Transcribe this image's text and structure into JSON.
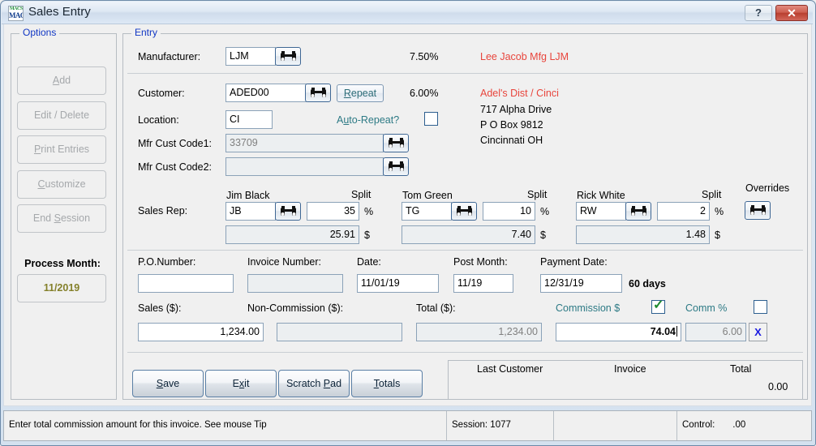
{
  "window": {
    "title": "Sales Entry",
    "icon_top": "MACS",
    "icon_bottom": "MACS",
    "help_label": "?",
    "close_label": "✕"
  },
  "options": {
    "group_title": "Options",
    "buttons": [
      {
        "label": "Add",
        "accel": "A",
        "disabled": true
      },
      {
        "label": "Edit / Delete",
        "accel": "",
        "disabled": true
      },
      {
        "label": "Print Entries",
        "accel": "P",
        "disabled": true
      },
      {
        "label": "Customize",
        "accel": "C",
        "disabled": true
      },
      {
        "label": "End Session",
        "accel": "S",
        "disabled": true
      }
    ],
    "process_month_label": "Process Month:",
    "process_month_value": "11/2019",
    "process_month_color": "#84802a"
  },
  "entry": {
    "group_title": "Entry",
    "manufacturer": {
      "label": "Manufacturer:",
      "value": "LJM",
      "rate": "7.50%",
      "name": "Lee Jacob Mfg  LJM"
    },
    "customer": {
      "label": "Customer:",
      "value": "ADED00",
      "repeat_button": "Repeat",
      "repeat_accel": "R",
      "rate": "6.00%",
      "name": "Adel's Dist / Cinci",
      "address_line1": "717 Alpha Drive",
      "address_line2": "P O Box 9812",
      "address_line3": "Cincinnati OH"
    },
    "location": {
      "label": "Location:",
      "value": "CI",
      "auto_repeat_label": "Auto-Repeat?",
      "auto_repeat_accel": "u",
      "auto_repeat_checked": false
    },
    "mfr_cust_code1": {
      "label": "Mfr Cust Code1:",
      "value": "33709",
      "readonly": true
    },
    "mfr_cust_code2": {
      "label": "Mfr Cust Code2:",
      "value": "",
      "readonly": true
    },
    "sales_rep": {
      "label": "Sales Rep:",
      "split_label": "Split",
      "percent_symbol": "%",
      "dollar_symbol": "$",
      "overrides_label": "Overrides",
      "reps": [
        {
          "name": "Jim Black",
          "code": "JB",
          "split": "35",
          "amount": "25.91"
        },
        {
          "name": "Tom Green",
          "code": "TG",
          "split": "10",
          "amount": "7.40"
        },
        {
          "name": "Rick White",
          "code": "RW",
          "split": "2",
          "amount": "1.48"
        }
      ]
    },
    "po_number": {
      "label": "P.O.Number:",
      "value": ""
    },
    "invoice_number": {
      "label": "Invoice Number:",
      "value": "",
      "readonly": true
    },
    "date": {
      "label": "Date:",
      "value": "11/01/19"
    },
    "post_month": {
      "label": "Post Month:",
      "value": "11/19"
    },
    "payment_date": {
      "label": "Payment Date:",
      "value": "12/31/19",
      "days": "60  days"
    },
    "sales": {
      "label": "Sales ($):",
      "value": "1,234.00"
    },
    "non_commission": {
      "label": "Non-Commission ($):",
      "value": "",
      "readonly": true
    },
    "total": {
      "label": "Total ($):",
      "value": "1,234.00",
      "readonly": true
    },
    "commission_dollar": {
      "label": "Commission $",
      "value": "74.04",
      "checked": true,
      "focused": true
    },
    "commission_percent": {
      "label": "Comm %",
      "value": "6.00",
      "checked": false,
      "readonly": true
    },
    "clear_button": "X"
  },
  "actions": {
    "save": {
      "label": "Save",
      "accel": "S"
    },
    "exit": {
      "label": "Exit",
      "accel": "x"
    },
    "scratch_pad": {
      "label": "Scratch Pad",
      "accel": "P"
    },
    "totals": {
      "label": "Totals",
      "accel": "T"
    }
  },
  "summary": {
    "last_customer_label": "Last Customer",
    "invoice_label": "Invoice",
    "total_label": "Total",
    "total_value": "0.00"
  },
  "statusbar": {
    "message": "Enter total commission amount for this invoice. See mouse Tip",
    "session": "Session: 1077",
    "blank": "",
    "control_label": "Control:",
    "control_value": ".00"
  }
}
